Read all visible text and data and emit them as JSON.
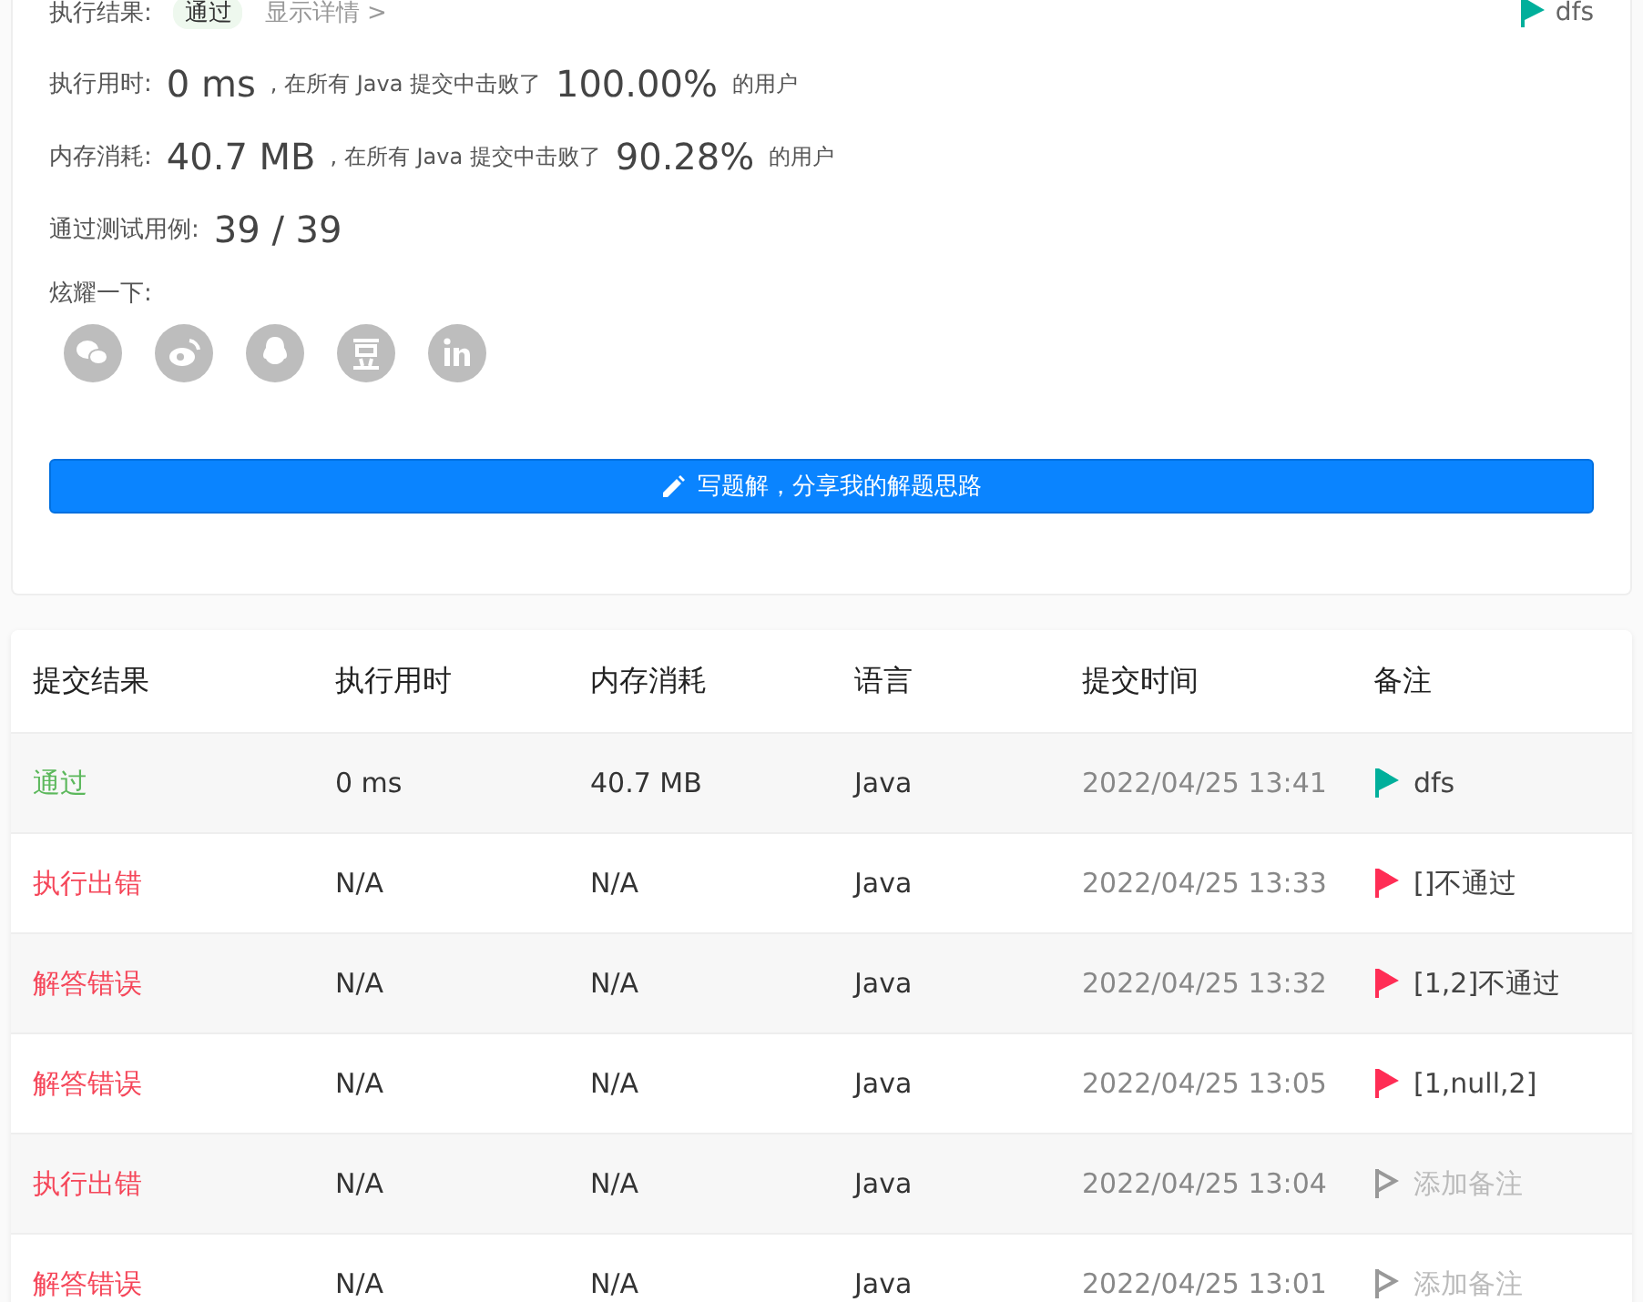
{
  "result": {
    "label": "执行结果:",
    "status": "通过",
    "details_link": "显示详情 >",
    "note": {
      "kind": "tag",
      "label": "dfs",
      "color": "#00af9b"
    }
  },
  "stats": [
    {
      "label": "执行用时:",
      "value": "0 ms",
      "middle": ", 在所有 Java 提交中击败了",
      "percent": "100.00%",
      "suffix": "的用户"
    },
    {
      "label": "内存消耗:",
      "value": "40.7 MB",
      "middle": ", 在所有 Java 提交中击败了",
      "percent": "90.28%",
      "suffix": "的用户"
    }
  ],
  "tests": {
    "label": "通过测试用例:",
    "value": "39 / 39"
  },
  "share": {
    "label": "炫耀一下:",
    "icons": [
      {
        "kind": "wechat"
      },
      {
        "kind": "weibo"
      },
      {
        "kind": "qq"
      },
      {
        "kind": "douban"
      },
      {
        "kind": "linkedin"
      }
    ]
  },
  "write_button": "写题解，分享我的解题思路",
  "table": {
    "columns": [
      "提交结果",
      "执行用时",
      "内存消耗",
      "语言",
      "提交时间",
      "备注"
    ],
    "rows": [
      {
        "status": {
          "label": "通过",
          "color": "#5cb85c"
        },
        "time": "0 ms",
        "memory": "40.7 MB",
        "language": "Java",
        "submitted": "2022/04/25 13:41",
        "note": {
          "kind": "tag",
          "label": "dfs",
          "color": "#00af9b"
        }
      },
      {
        "status": {
          "label": "执行出错",
          "color": "#f5475a"
        },
        "time": "N/A",
        "memory": "N/A",
        "language": "Java",
        "submitted": "2022/04/25 13:33",
        "note": {
          "kind": "tag",
          "label": "[]不通过",
          "color": "#ff2d55"
        }
      },
      {
        "status": {
          "label": "解答错误",
          "color": "#f5475a"
        },
        "time": "N/A",
        "memory": "N/A",
        "language": "Java",
        "submitted": "2022/04/25 13:32",
        "note": {
          "kind": "tag",
          "label": "[1,2]不通过",
          "color": "#ff2d55"
        }
      },
      {
        "status": {
          "label": "解答错误",
          "color": "#f5475a"
        },
        "time": "N/A",
        "memory": "N/A",
        "language": "Java",
        "submitted": "2022/04/25 13:05",
        "note": {
          "kind": "tag",
          "label": "[1,null,2]",
          "color": "#ff2d55"
        }
      },
      {
        "status": {
          "label": "执行出错",
          "color": "#f5475a"
        },
        "time": "N/A",
        "memory": "N/A",
        "language": "Java",
        "submitted": "2022/04/25 13:04",
        "note": {
          "kind": "add",
          "label": "添加备注"
        }
      },
      {
        "status": {
          "label": "解答错误",
          "color": "#f5475a"
        },
        "time": "N/A",
        "memory": "N/A",
        "language": "Java",
        "submitted": "2022/04/25 13:01",
        "note": {
          "kind": "add",
          "label": "添加备注"
        }
      }
    ]
  }
}
